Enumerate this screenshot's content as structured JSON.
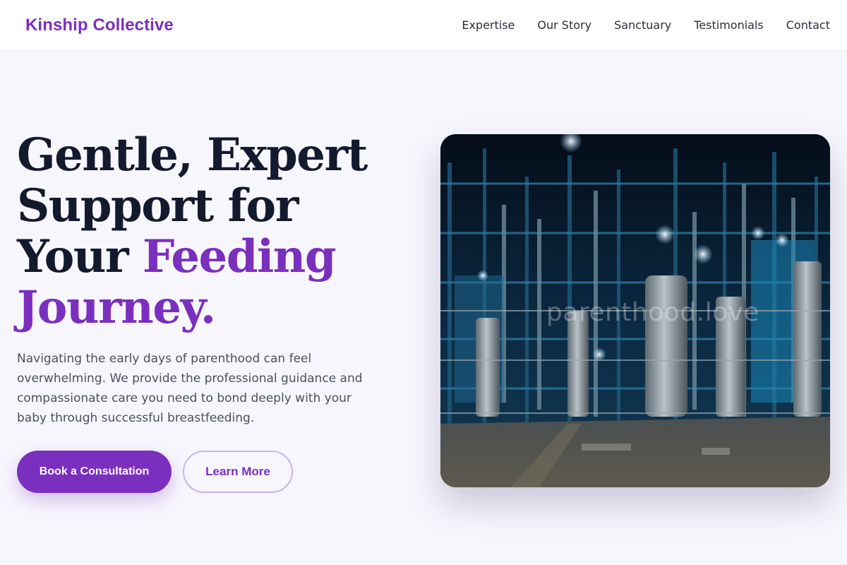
{
  "brand": {
    "name": "Kinship Collective",
    "accent_color": "#7b2fbe"
  },
  "nav": {
    "items": [
      {
        "label": "Expertise"
      },
      {
        "label": "Our Story"
      },
      {
        "label": "Sanctuary"
      },
      {
        "label": "Testimonials"
      },
      {
        "label": "Contact"
      }
    ]
  },
  "hero": {
    "title_lines": [
      "Gentle, Expert",
      "Support for",
      "Your "
    ],
    "title_accent_1": "Feeding",
    "title_accent_2": "Journey.",
    "description": "Navigating the early days of parenthood can feel overwhelming. We provide the professional guidance and compassionate care you need to bond deeply with your baby through successful breastfeeding.",
    "primary_button": "Book a Consultation",
    "secondary_button": "Learn More",
    "image_watermark": "parenthood.love"
  }
}
